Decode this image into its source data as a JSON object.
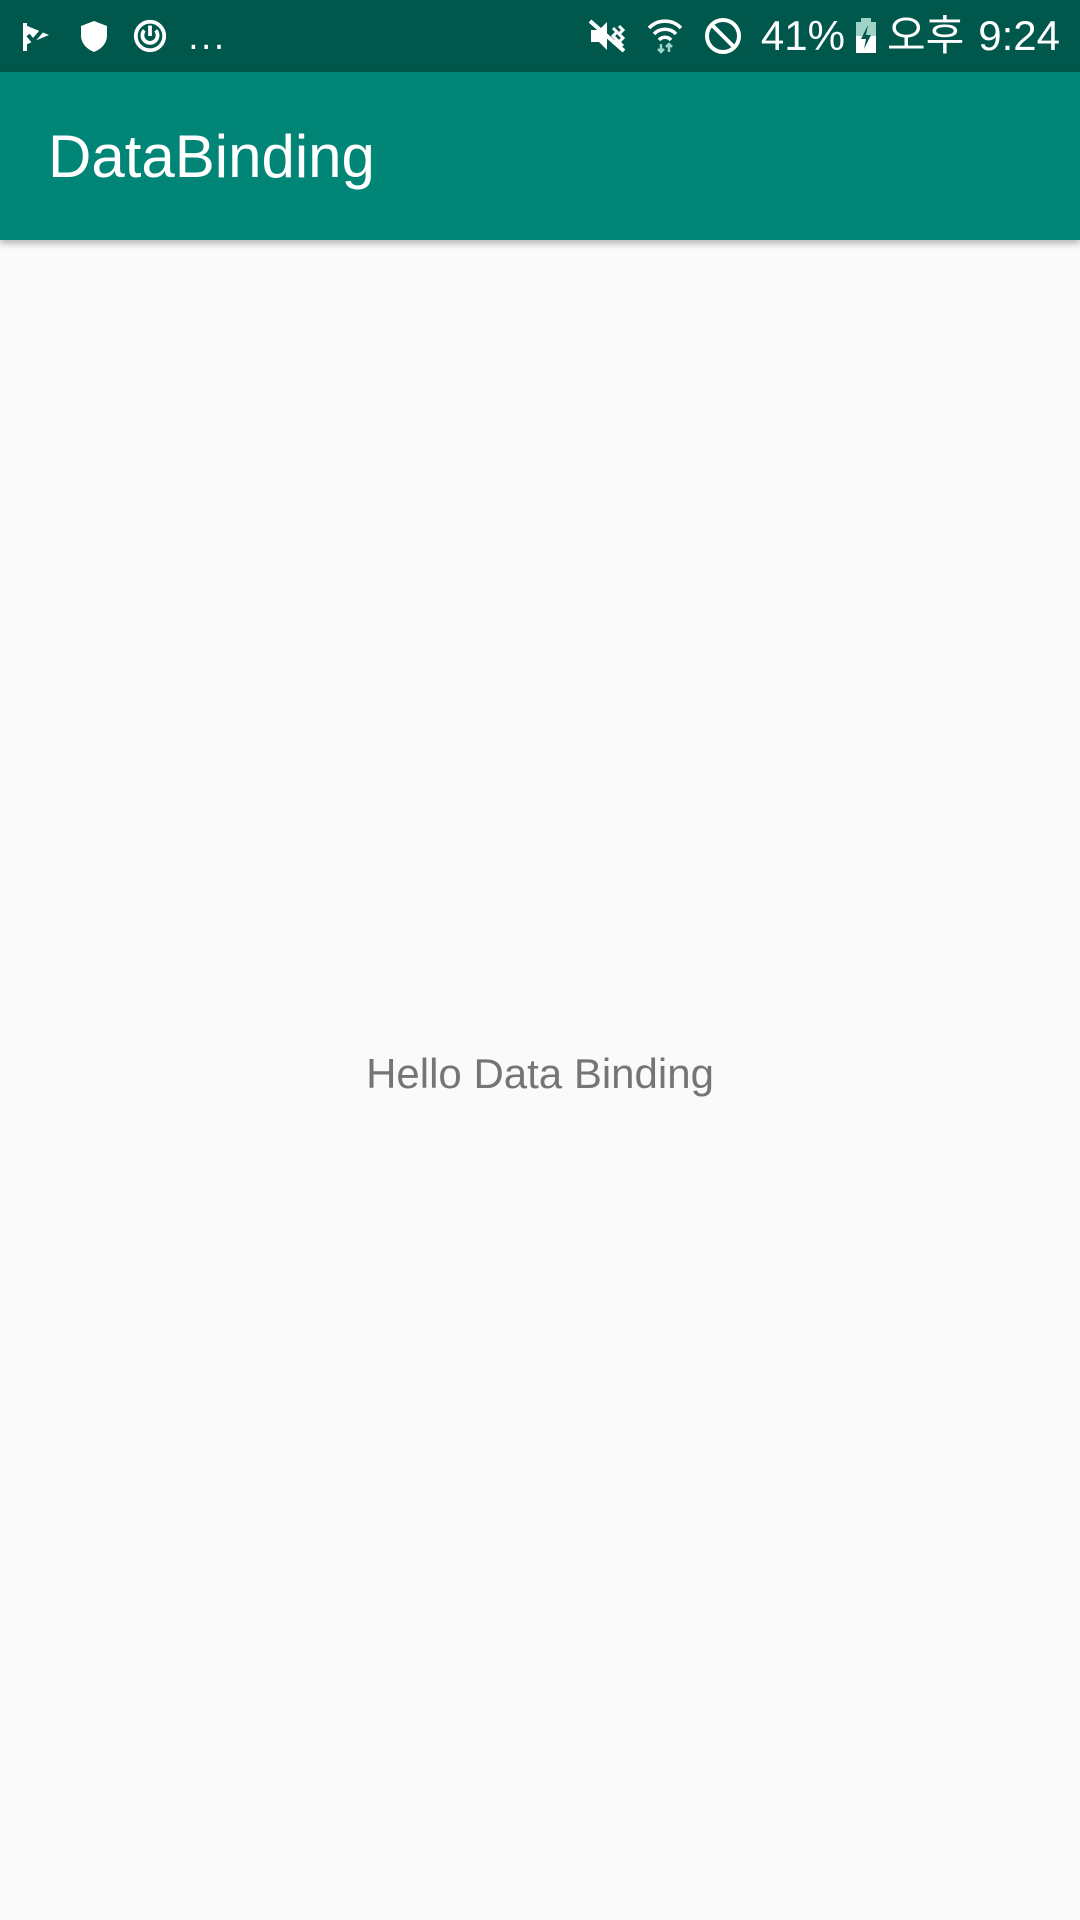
{
  "status_bar": {
    "left_icons": [
      "check-flag-icon",
      "shield-icon",
      "power-icon"
    ],
    "overflow": "...",
    "right_icons": [
      "mute-vibrate-icon",
      "wifi-icon",
      "do-not-disturb-icon"
    ],
    "battery_percent": "41%",
    "ampm": "오후",
    "time": "9:24"
  },
  "app_bar": {
    "title": "DataBinding",
    "color": "#008577"
  },
  "content": {
    "message": "Hello Data Binding"
  },
  "colors": {
    "status_bar": "#00574b",
    "background": "#fafafa",
    "message_text": "#757575"
  }
}
